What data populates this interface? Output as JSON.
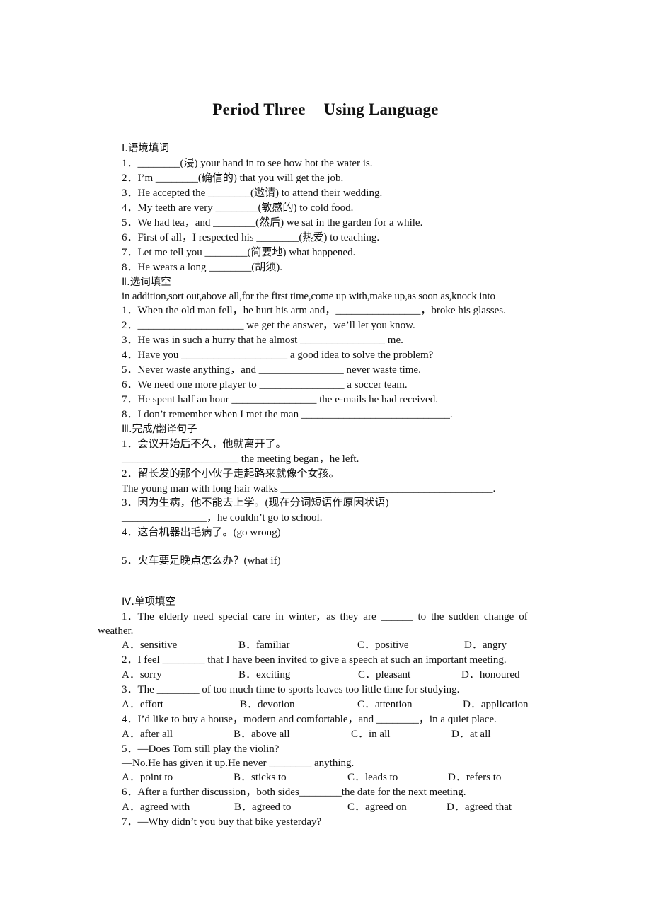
{
  "title": {
    "part1": "Period Three",
    "part2": "Using Language"
  },
  "section1": {
    "heading": "Ⅰ.语境填词",
    "items": [
      "1．________(浸) your hand in to see how hot the water is.",
      "2．I’m ________(确信的) that you will get the job.",
      "3．He accepted the ________(邀请) to attend their wedding.",
      "4．My teeth are very ________(敏感的) to cold food.",
      "5．We had tea，and ________(然后) we sat in the garden for a while.",
      "6．First of all，I respected his ________(热爱) to teaching.",
      "7．Let me tell you ________(简要地) what happened.",
      "8．He wears a long ________(胡须)."
    ]
  },
  "section2": {
    "heading": "Ⅱ.选词填空",
    "word_bank": "in addition,sort out,above all,for the first time,come up with,make up,as soon as,knock into",
    "items": [
      "1．When the old man fell，he hurt his arm and，________________，broke his glasses.",
      "2．____________________ we get the answer，we’ll let you know.",
      "3．He was in such a hurry that he almost ________________ me.",
      "4．Have you ____________________ a good idea to solve the problem?",
      "5．Never waste anything，and ________________ never waste time.",
      "6．We need one more player to ________________ a soccer team.",
      "7．He spent half an hour ________________ the e-mails he had received.",
      "8．I don’t remember when I met the man ____________________________."
    ]
  },
  "section3": {
    "heading": "Ⅲ.完成/翻译句子",
    "items": [
      {
        "prompt": "1．会议开始后不久，他就离开了。",
        "answer": "______________________ the meeting began，he left."
      },
      {
        "prompt": "2．留长发的那个小伙子走起路来就像个女孩。",
        "answer": "The young man with long hair walks ________________________________________."
      },
      {
        "prompt": "3．因为生病，他不能去上学。(现在分词短语作原因状语)",
        "answer": "________________，he couldn’t go to school."
      },
      {
        "prompt": "4．这台机器出毛病了。(go wrong)",
        "answer": ""
      },
      {
        "prompt": "5．火车要是晚点怎么办？(what if)",
        "answer": ""
      }
    ]
  },
  "section4": {
    "heading": "Ⅳ.单项填空",
    "questions": [
      {
        "stem": [
          "1．The elderly need special care in winter，as they are ______ to the sudden change of",
          "weather."
        ],
        "options": [
          "A．sensitive",
          "B．familiar",
          "C．positive",
          "D．angry"
        ]
      },
      {
        "stem": [
          "2．I feel ________ that I have been invited to give a speech at such an important meeting."
        ],
        "options": [
          "A．sorry",
          "B．exciting",
          "C．pleasant",
          "D．honoured"
        ]
      },
      {
        "stem": [
          "3．The ________ of too much time to sports leaves too little time for studying."
        ],
        "options": [
          "A．effort",
          "B．devotion",
          "C．attention",
          "D．application"
        ]
      },
      {
        "stem": [
          "4．I’d like to buy a house，modern and comfortable，and ________，in a quiet place."
        ],
        "options": [
          "A．after all",
          "B．above all",
          "C．in all",
          "D．at all"
        ]
      },
      {
        "stem": [
          "5．—Does Tom still play the violin?",
          "—No.He has given it up.He never ________ anything."
        ],
        "options": [
          "A．point to",
          "B．sticks to",
          "C．leads to",
          "D．refers to"
        ]
      },
      {
        "stem": [
          "6．After a further discussion，both sides________the date for the next meeting."
        ],
        "options": [
          "A．agreed with",
          "B．agreed to",
          "C．agreed on",
          "D．agreed that"
        ]
      },
      {
        "stem": [
          "7．—Why didn’t you buy that bike yesterday?"
        ],
        "options": []
      }
    ]
  }
}
